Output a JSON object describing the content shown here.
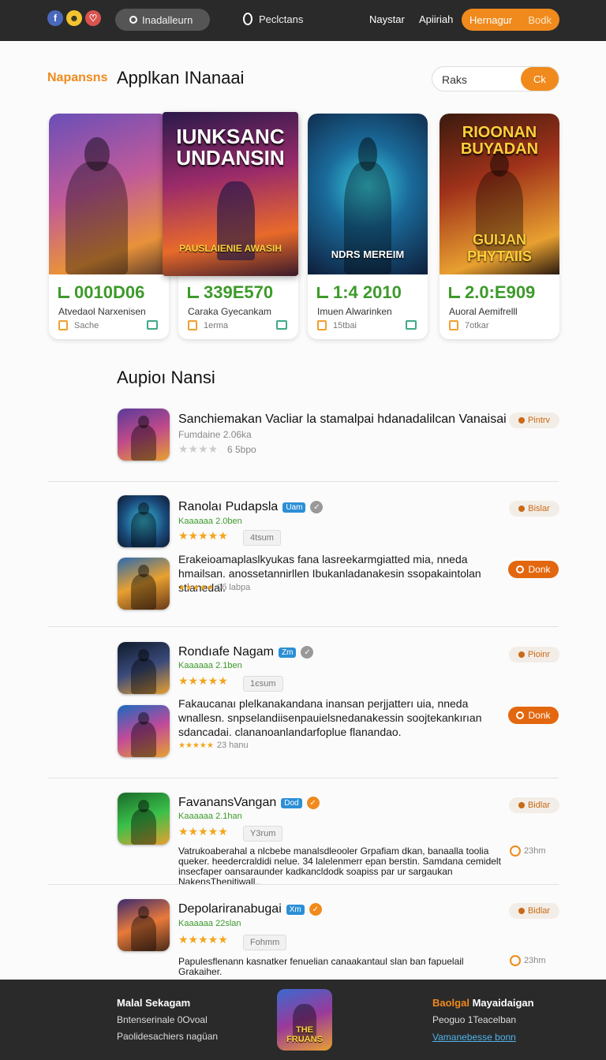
{
  "nav": {
    "social": [
      "f",
      "☻",
      "♡"
    ],
    "search_label": "Inadalleurn",
    "center_label": "Peclctans",
    "link1": "Naystar",
    "link2": "Apiiriah",
    "cta_left": "Hernagur",
    "cta_right": "Bodk"
  },
  "header": {
    "brand": "Napansns",
    "title": "Applkan INanaai",
    "search_text": "Raks",
    "search_button": "Ck"
  },
  "cards": [
    {
      "headline": "",
      "tag": "",
      "score": "0010D06",
      "subtitle": "Atvedaol Narxenisen",
      "meta": "Sache"
    },
    {
      "headline": "",
      "tag": "",
      "score": "339E570",
      "subtitle": "Caraka Gyecankam",
      "meta": "1erma"
    },
    {
      "headline": "",
      "tag": "NDRS MEREIM",
      "score": "1:4 2010",
      "subtitle": "Imuen Alwarinken",
      "meta": "15tbai"
    },
    {
      "headline": "RIOONAN BUYADAN",
      "tag": "GUIJAN PHYTAIIS",
      "score": "2.0:E909",
      "subtitle": "Auoral Aemifrelll",
      "meta": "7otkar"
    }
  ],
  "featured": {
    "headline": "IUNKSANC UNDANSIN",
    "tag": "PAUSLAIENIE AWASIH"
  },
  "section_title": "Aupioı Nansi",
  "apps": [
    {
      "title": "Sanchiemakan Vacliar la stamalpai hdanadalilcan Vanaisai",
      "sub": "Fumdaine 2.06ka",
      "meta": "6 5bpo",
      "side": "Pintrv"
    },
    {
      "title": "Ranolaı Pudapsla",
      "badge": "Uam",
      "green": "Kaaaaaa 2.0ben",
      "pill": "4tsum",
      "side": "Bislar",
      "desc": "Erakeioamaplaslkyukas fana lasreekarmgiatted mia, nneda hmailsan. anossetannirllen Ibukanladanakesin ssopakaintolan stianedal.",
      "small_meta": "0б labpa",
      "button": "Donk"
    },
    {
      "title": "Rondıafe Nagam",
      "badge": "Zm",
      "green": "Kaaaaaa 2.1ben",
      "pill": "1єsum",
      "side": "Pioinr",
      "desc": "Fakaucanaı plelkanakandana inansan perjjatterı uia, nneda wnallesn. snpselandiisenpauielsnedanakessin soojtekankırıan sdancadai. clananoanlandarfoplue flanandao.",
      "small_meta": "23 hanu",
      "button": "Donk"
    },
    {
      "title": "FavanansVangan",
      "badge": "Dod",
      "green": "Kaaaaaa 2.1han",
      "pill": "Y3rum",
      "side": "Bidlar",
      "desc": "Vatrukoaberahal a nlcbebe manalsdleooler Grpafiam dkan, banaalla toolia queker. heedercraldidi nelue. 34 lalelenmerr epan berstin. Samdana cemidelt insecfaper oansaraunder kadkancldodk soapiss par ur sargaukan NakensThenitiwall..",
      "clock": "23hm"
    },
    {
      "title": "Depolariranabugai",
      "badge": "Xm",
      "green": "Kaaaaaa 22slan",
      "pill": "Fohmm",
      "side": "Bidlar",
      "desc": "Papulesflenann kasnatker fenuelian canaakantaul slan ban fapuelail Grakaiher.",
      "clock": "23hm"
    }
  ],
  "footer": {
    "col1_title": "Malal Sekagam",
    "col1_line1": "Bntenserinale 0Ovoal",
    "col1_line2": "Paolidesachiers nagüan",
    "col2_title_a": "Baolgal",
    "col2_title_b": " Mayaidaigan",
    "col2_line1": "Peoguo 1Teacelban",
    "col2_link": "Vamanebesse bonn",
    "logo_text": "THE FRUANS"
  },
  "colors": {
    "accent": "#f08a1c",
    "green": "#3d9a2a",
    "nav": "#2a2a2a"
  }
}
